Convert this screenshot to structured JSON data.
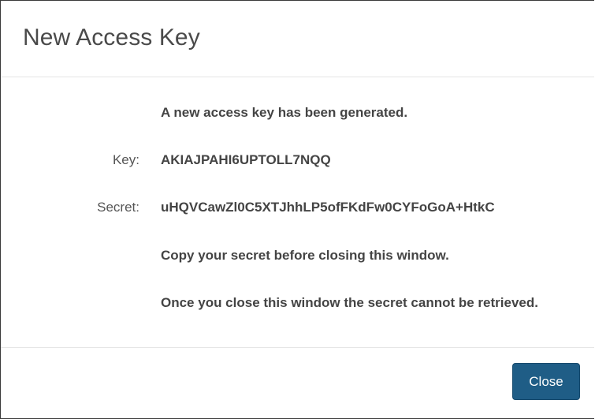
{
  "dialog": {
    "title": "New Access Key"
  },
  "body": {
    "message": "A new access key has been generated.",
    "key_label": "Key:",
    "key_value": "AKIAJPAHI6UPTOLL7NQQ",
    "secret_label": "Secret:",
    "secret_value": "uHQVCawZl0C5XTJhhLP5ofFKdFw0CYFoGoA+HtkC",
    "copy_warning": "Copy your secret before closing this window.",
    "retrieval_warning": "Once you close this window the secret cannot be retrieved."
  },
  "footer": {
    "close_label": "Close"
  },
  "colors": {
    "primary_button": "#1f5d86",
    "title_text": "#4a4a4a",
    "body_text": "#444444"
  }
}
